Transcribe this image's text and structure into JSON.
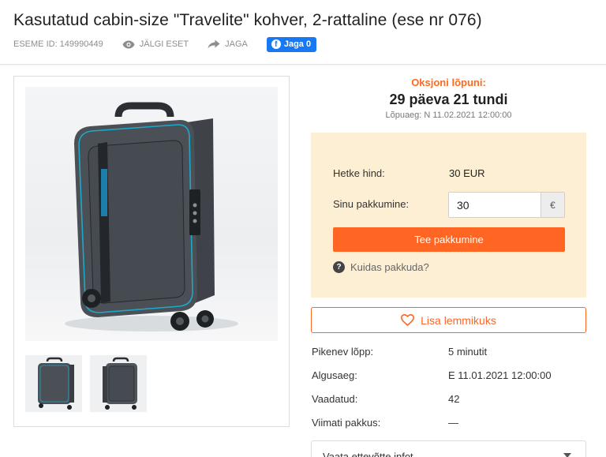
{
  "header": {
    "title": "Kasutatud cabin-size \"Travelite\" kohver, 2-rattaline (ese nr 076)",
    "item_id": "ESEME ID: 149990449",
    "follow_label": "JÄLGI ESET",
    "share_label": "JAGA",
    "fb_label": "Jaga 0"
  },
  "gallery": {
    "main_image_alt": "",
    "thumbnails": [
      "",
      ""
    ]
  },
  "auction": {
    "ends_label": "Oksjoni lõpuni:",
    "countdown": "29 päeva 21 tundi",
    "deadline": "Lõpuaeg: N 11.02.2021 12:00:00"
  },
  "bid": {
    "current_price_label": "Hetke hind:",
    "current_price": "30 EUR",
    "your_bid_label": "Sinu pakkumine:",
    "your_bid_value": "30",
    "currency_symbol": "€",
    "submit_label": "Tee pakkumine",
    "howto_label": "Kuidas pakkuda?"
  },
  "favourite_label": "Lisa lemmikuks",
  "details": [
    {
      "key": "Pikenev lõpp:",
      "value": "5 minutit"
    },
    {
      "key": "Algusaeg:",
      "value": "E 11.01.2021 12:00:00"
    },
    {
      "key": "Vaadatud:",
      "value": "42"
    },
    {
      "key": "Viimati pakkus:",
      "value": "—"
    }
  ],
  "seller_label": "Vaata ettevõtte infot",
  "colors": {
    "accent": "#ff6624",
    "bid_box_bg": "#fdefd3",
    "facebook": "#1877f2"
  },
  "icons": [
    "eye-icon",
    "share-arrow-icon",
    "facebook-icon",
    "question-icon",
    "heart-icon",
    "chevron-down-icon"
  ]
}
